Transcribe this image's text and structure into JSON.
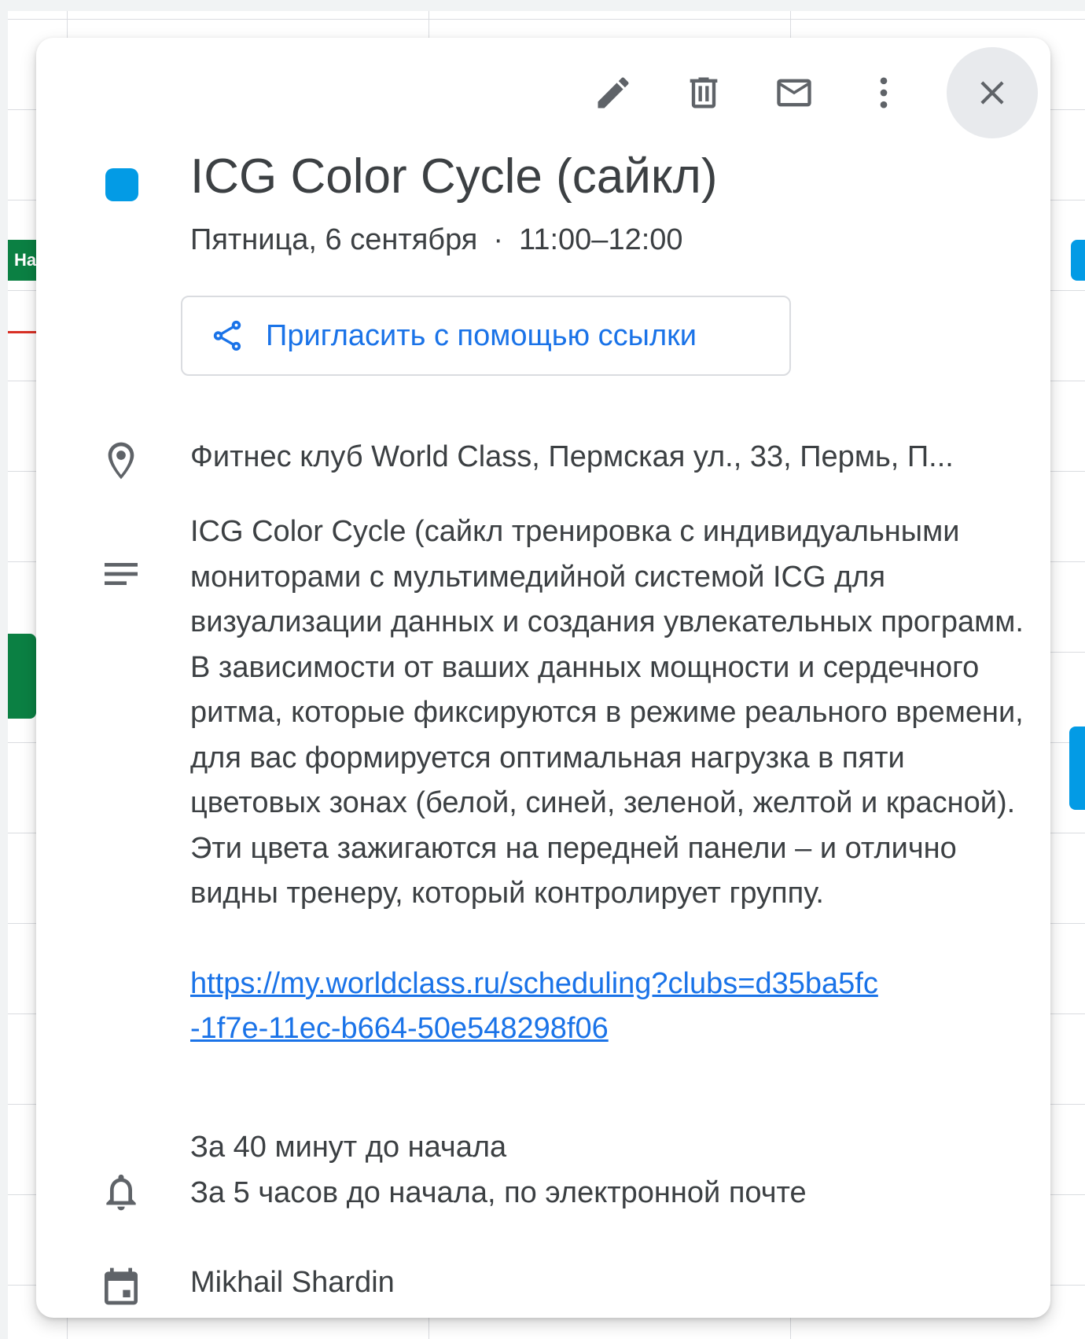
{
  "background": {
    "chip_left_label": "На"
  },
  "toolbar": {
    "edit_icon": "pencil-icon",
    "delete_icon": "trash-icon",
    "email_icon": "mail-icon",
    "more_icon": "more-vert-icon",
    "close_icon": "close-icon"
  },
  "event": {
    "color": "#039be5",
    "title": "ICG Color Cycle (сайкл)",
    "date": "Пятница, 6 сентября",
    "separator": "·",
    "time": "11:00–12:00",
    "invite_label": "Пригласить с помощью ссылки",
    "location": "Фитнес клуб World Class, Пермская ул., 33, Пермь, П...",
    "description": "ICG Color Cycle (сайкл тренировка с индивидуальными мониторами с мультимедийной системой ICG для визуализации данных и создания увлекательных программ. В зависимости от ваших данных мощности и сердечного ритма, которые фиксируются в режиме реального времени, для вас формируется оптимальная нагрузка в пяти цветовых зонах (белой, синей, зеленой, желтой и красной). Эти цвета зажигаются на передней панели – и отлично видны тренеру, который контролирует группу.",
    "description_link": "https://my.worldclass.ru/scheduling?clubs=d35ba5fc-1f7e-11ec-b664-50e548298f06",
    "reminders": [
      "За 40 минут до начала",
      "За 5 часов до начала, по электронной почте"
    ],
    "owner": "Mikhail Shardin"
  },
  "colors": {
    "accent": "#1a73e8",
    "text": "#3c4043",
    "icon": "#5f6368"
  }
}
